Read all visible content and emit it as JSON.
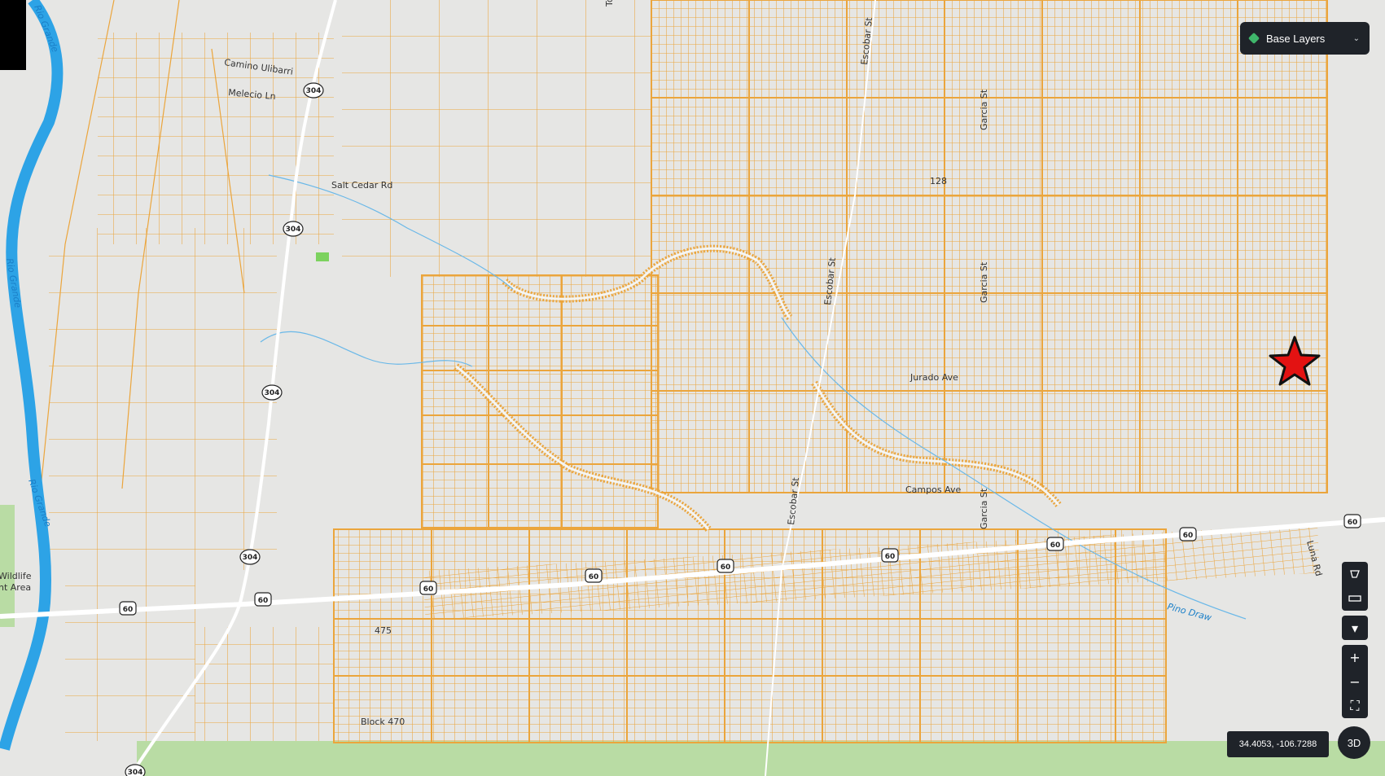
{
  "controls": {
    "base_layers_label": "Base Layers",
    "zoom_in": "+",
    "zoom_out": "−",
    "fullscreen": "⛶",
    "dropdown": "▾",
    "btn_3d": "3D",
    "coordinates": "34.4053, -106.7288"
  },
  "labels": {
    "river_1": "Rio Grande",
    "river_2": "Rio Grande",
    "river_3": "Rio Grande",
    "camino": "Camino Ulibarri",
    "melecio": "Melecio Ln",
    "salt_cedar": "Salt Cedar Rd",
    "escobar_1": "Escobar St",
    "escobar_2": "Escobar St",
    "escobar_3": "Escobar St",
    "garcia_1": "Garcia St",
    "garcia_2": "Garcia St",
    "garcia_3": "Garcia St",
    "num_128": "128",
    "jurado": "Jurado Ave",
    "campos": "Campos Ave",
    "luna": "Luna Rd",
    "pino": "Pino Draw",
    "num_475": "475",
    "block_470": "Block 470",
    "wildlife_1": "Wildlife",
    "wildlife_2": "nt Area",
    "tor": "Tor"
  },
  "shields": {
    "us60": "60",
    "nm304": "304"
  },
  "colors": {
    "parcel": "#eba53c",
    "background": "#e6e6e4",
    "river": "#2da3e6",
    "highway": "#ffffff",
    "green_area": "#b9dca4",
    "marker": "#e31212"
  },
  "marker_icon": "star-marker-icon"
}
